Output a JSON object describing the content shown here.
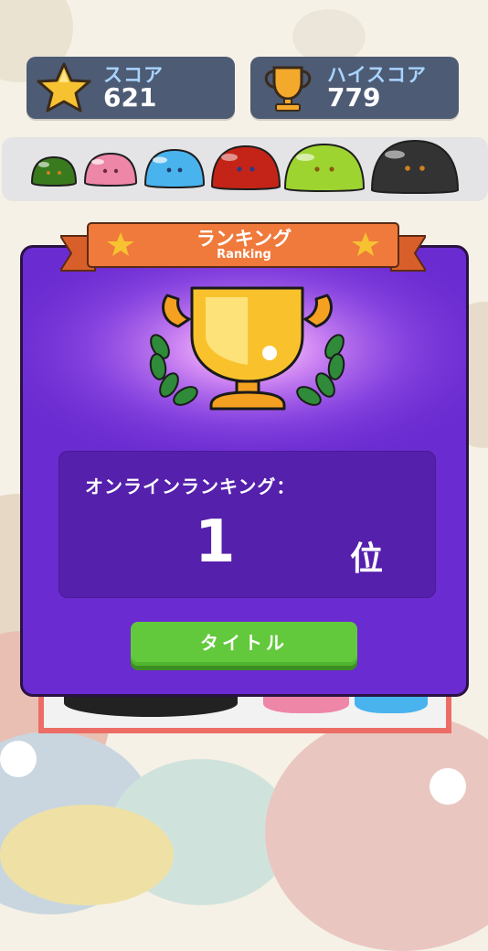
{
  "header": {
    "score": {
      "label": "スコア",
      "value": "621",
      "icon": "star-icon"
    },
    "high_score": {
      "label": "ハイスコア",
      "value": "779",
      "icon": "trophy-icon"
    }
  },
  "slime_evolution": [
    {
      "name": "green-slime",
      "color": "#3a7a1e"
    },
    {
      "name": "pink-slime",
      "color": "#ee86a8"
    },
    {
      "name": "blue-slime",
      "color": "#49b3ee"
    },
    {
      "name": "red-slime",
      "color": "#c42418"
    },
    {
      "name": "lime-slime",
      "color": "#9ed430"
    },
    {
      "name": "black-slime",
      "color": "#333333"
    }
  ],
  "ranking_dialog": {
    "title": "ランキング",
    "subtitle": "Ranking",
    "online_ranking_label": "オンラインランキング：",
    "rank_value": "1",
    "rank_unit": "位",
    "title_button_label": "タイトル"
  },
  "colors": {
    "panel": "#6a2bd0",
    "banner": "#ef7a3c",
    "button": "#63c93c",
    "score_card": "#4d5b74"
  }
}
